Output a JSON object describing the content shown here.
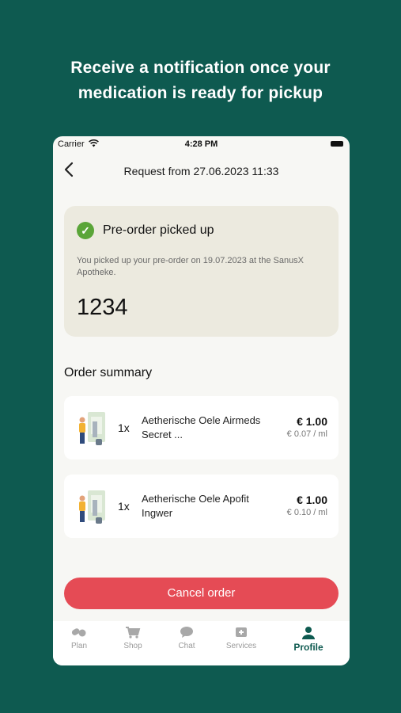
{
  "headline": {
    "line1": "Receive a notification once your",
    "line2": "medication is ready for pickup"
  },
  "statusbar": {
    "carrier": "Carrier",
    "time": "4:28 PM"
  },
  "navbar": {
    "title": "Request from 27.06.2023 11:33"
  },
  "status_card": {
    "title": "Pre-order picked up",
    "description": "You picked up your pre-order on 19.07.2023 at the SanusX Apotheke.",
    "code": "1234"
  },
  "summary": {
    "title": "Order summary",
    "items": [
      {
        "qty": "1x",
        "name": "Aetherische Oele Airmeds Secret ...",
        "price": "€ 1.00",
        "unit_price": "€ 0.07 / ml"
      },
      {
        "qty": "1x",
        "name": "Aetherische Oele Apofit Ingwer",
        "price": "€ 1.00",
        "unit_price": "€ 0.10 / ml"
      }
    ]
  },
  "cancel_button": "Cancel order",
  "tabs": [
    {
      "label": "Plan",
      "icon": "pills-icon"
    },
    {
      "label": "Shop",
      "icon": "cart-icon"
    },
    {
      "label": "Chat",
      "icon": "chat-bubble-icon"
    },
    {
      "label": "Services",
      "icon": "services-icon"
    },
    {
      "label": "Profile",
      "icon": "person-icon"
    }
  ],
  "colors": {
    "background": "#0e5a50",
    "accent_red": "#e54b55",
    "success_green": "#5aa538",
    "card_beige": "#eceadf"
  }
}
